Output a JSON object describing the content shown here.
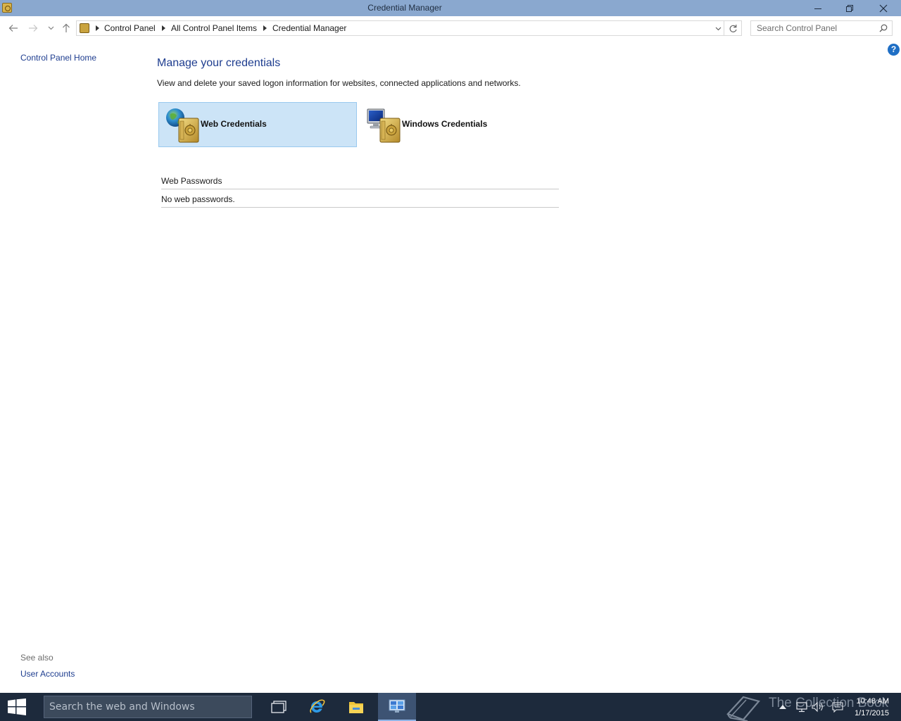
{
  "window": {
    "title": "Credential Manager"
  },
  "address_bar": {
    "breadcrumbs": [
      "Control Panel",
      "All Control Panel Items",
      "Credential Manager"
    ]
  },
  "search": {
    "placeholder": "Search Control Panel"
  },
  "left_pane": {
    "home_link": "Control Panel Home",
    "see_also_label": "See also",
    "see_also_links": [
      "User Accounts"
    ]
  },
  "main": {
    "title": "Manage your credentials",
    "description": "View and delete your saved logon information for websites, connected applications and networks.",
    "tiles": [
      {
        "label": "Web Credentials",
        "selected": true
      },
      {
        "label": "Windows Credentials",
        "selected": false
      }
    ],
    "section_header": "Web Passwords",
    "empty_message": "No web passwords."
  },
  "help": {
    "label": "?"
  },
  "taskbar": {
    "search_placeholder": "Search the web and Windows",
    "watermark": "The Collection Book",
    "clock_time": "10:48 AM",
    "clock_date": "1/17/2015"
  },
  "colors": {
    "title_bar": "#8aa8cf",
    "link": "#1e3d8f",
    "selected_tile": "#cce4f7",
    "taskbar": "#1d2a3c"
  },
  "icons": {
    "web_credentials": "globe-vault-icon",
    "windows_credentials": "monitor-vault-icon"
  }
}
